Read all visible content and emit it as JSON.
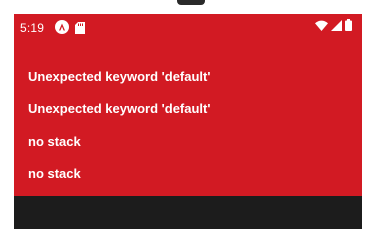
{
  "status_bar": {
    "time": "5:19",
    "left_icons": [
      "react-native-app-icon",
      "sd-card-icon"
    ],
    "right_icons": [
      "wifi-icon",
      "cell-signal-icon",
      "battery-icon"
    ],
    "background": "#d21a23"
  },
  "error_screen": {
    "background": "#d21a23",
    "lines": [
      "Unexpected keyword 'default'",
      "Unexpected keyword 'default'",
      "no stack",
      "no stack"
    ]
  }
}
